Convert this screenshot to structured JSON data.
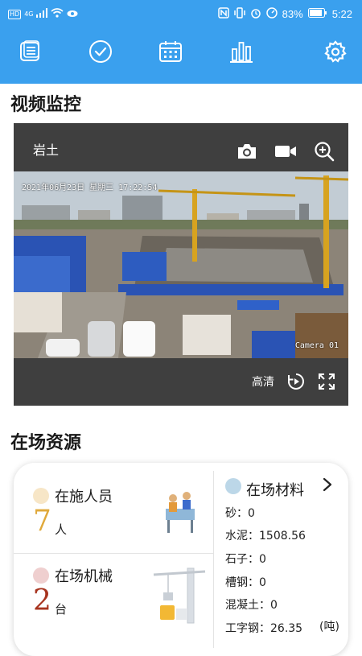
{
  "statusbar": {
    "left_hd": "HD",
    "left_signal": "4G",
    "battery_percent": "83%",
    "time": "5:22"
  },
  "toolbar": {
    "icons": [
      "list-icon",
      "check-circle-icon",
      "calendar-icon",
      "bar-chart-icon",
      "gear-icon"
    ]
  },
  "video_section": {
    "title": "视频监控",
    "camera_name": "岩土",
    "osd_datetime": "2021年06月23日  星期三  17:22:54",
    "osd_camera": "Camera 01",
    "quality_label": "高清"
  },
  "resources": {
    "title": "在场资源",
    "personnel": {
      "label": "在施人员",
      "value": "7",
      "unit": "人",
      "dot_color": "#f7e6c7",
      "value_color": "#e0a93b"
    },
    "machinery": {
      "label": "在场机械",
      "value": "2",
      "unit": "台",
      "dot_color": "#efcfcf",
      "value_color": "#a7341f"
    },
    "materials": {
      "title": "在场材料",
      "dot_color": "#bcd7e8",
      "items": [
        "砂：0",
        "水泥：1508.56",
        "石子：0",
        "槽钢：0",
        "混凝土：0",
        "工字钢：26.35"
      ],
      "unit_note": "(吨)"
    }
  }
}
